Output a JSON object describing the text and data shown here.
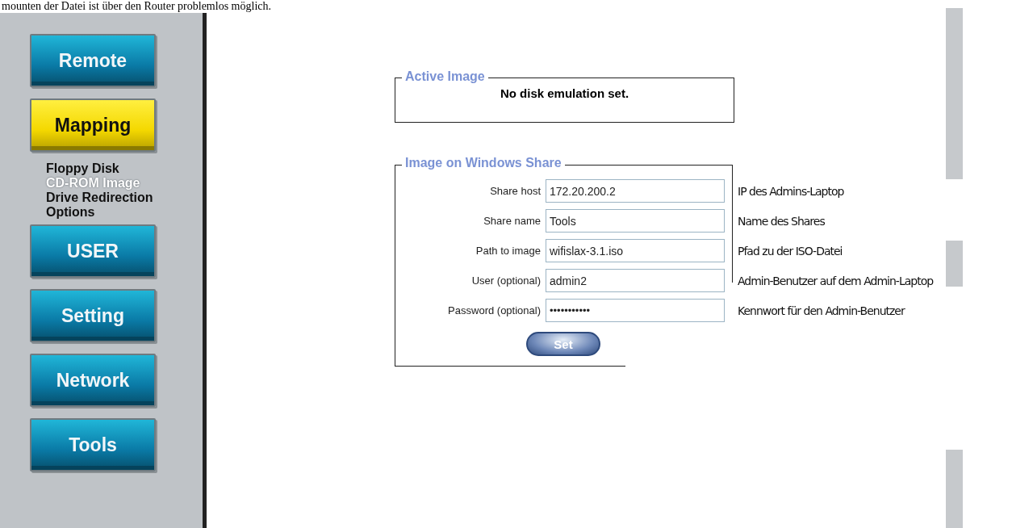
{
  "top_text": "mounten der Datei ist über den Router problemlos möglich.",
  "nav": [
    {
      "label": "Remote",
      "selected": false
    },
    {
      "label": "Mapping",
      "selected": true,
      "children": [
        {
          "label": "Floppy Disk",
          "selected": false
        },
        {
          "label": "CD-ROM Image",
          "selected": true
        },
        {
          "label": "Drive Redirection",
          "selected": false
        },
        {
          "label": "Options",
          "selected": false
        }
      ]
    },
    {
      "label": "USER",
      "selected": false
    },
    {
      "label": "Setting",
      "selected": false
    },
    {
      "label": "Network",
      "selected": false
    },
    {
      "label": "Tools",
      "selected": false
    }
  ],
  "active_image": {
    "legend": "Active Image",
    "status": "No disk emulation set."
  },
  "share": {
    "legend": "Image on Windows Share",
    "fields": [
      {
        "label": "Share host",
        "value": "172.20.200.2",
        "kind": "text",
        "annotation": "IP des Admins-Laptop"
      },
      {
        "label": "Share name",
        "value": "Tools",
        "kind": "text",
        "annotation": "Name des Shares"
      },
      {
        "label": "Path to image",
        "value": "wifislax-3.1.iso",
        "kind": "text",
        "annotation": "Pfad zu der ISO-Datei"
      },
      {
        "label": "User (optional)",
        "value": "admin2",
        "kind": "text",
        "annotation": "Admin-Benutzer auf dem Admin-Laptop"
      },
      {
        "label": "Password (optional)",
        "value": "•••••••••••",
        "kind": "password",
        "annotation": "Kennwort für den Admin-Benutzer"
      }
    ],
    "button": "Set"
  }
}
